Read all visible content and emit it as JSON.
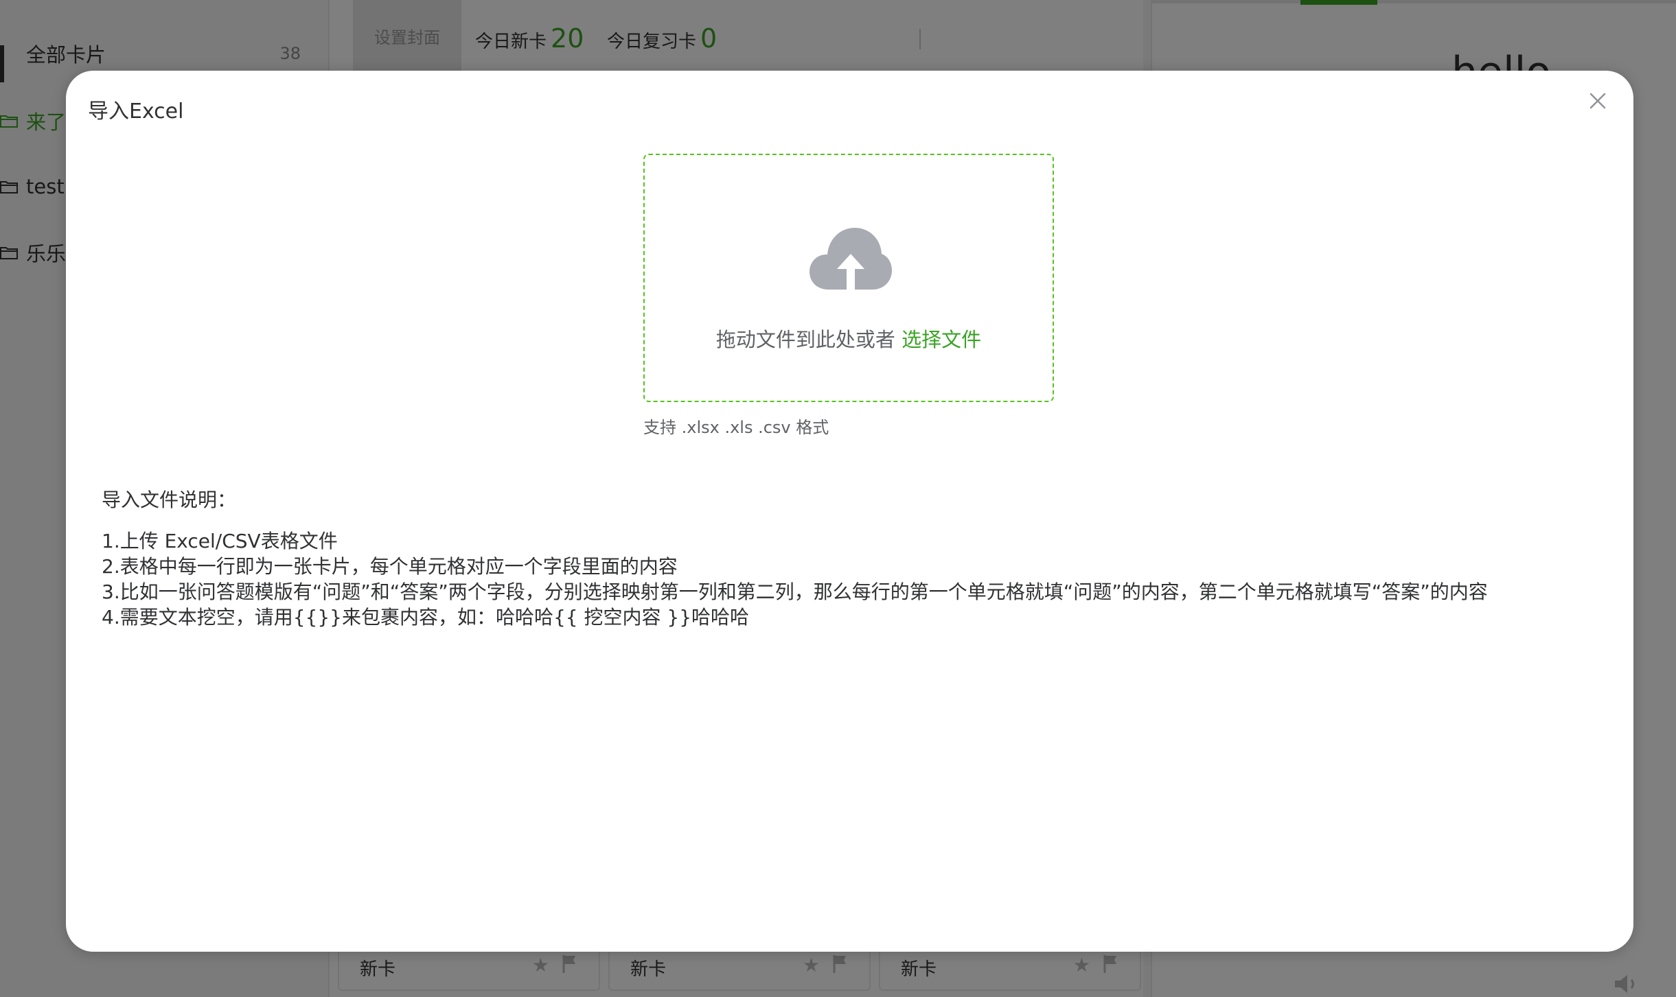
{
  "sidebar": {
    "items": [
      {
        "label": "全部卡片",
        "count": "38"
      },
      {
        "label": "来了"
      },
      {
        "label": "test"
      },
      {
        "label": "乐乐"
      }
    ]
  },
  "header": {
    "set_cover": "设置封面",
    "today_new_label": "今日新卡",
    "today_new_value": "20",
    "today_review_label": "今日复习卡",
    "today_review_value": "0"
  },
  "cards": [
    {
      "label": "新卡"
    },
    {
      "label": "新卡"
    },
    {
      "label": "新卡"
    }
  ],
  "preview": {
    "text": "hello"
  },
  "dialog": {
    "title": "导入Excel",
    "upload_text": "拖动文件到此处或者",
    "upload_link": "选择文件",
    "support_tip": "支持 .xlsx .xls .csv 格式",
    "desc_title": "导入文件说明：",
    "desc_lines": [
      "1.上传 Excel/CSV表格文件",
      "2.表格中每一行即为一张卡片，每个单元格对应一个字段里面的内容",
      "3.比如一张问答题模版有“问题”和“答案”两个字段，分别选择映射第一列和第二列，那么每行的第一个单元格就填“问题”的内容，第二个单元格就填写“答案”的内容",
      "4.需要文本挖空，请用{{}}来包裹内容，如：哈哈哈{{ 挖空内容 }}哈哈哈"
    ]
  },
  "colors": {
    "accent": "#3aa325",
    "dashed_border": "#52c41a",
    "overlay": "rgba(0,0,0,0.5)"
  }
}
